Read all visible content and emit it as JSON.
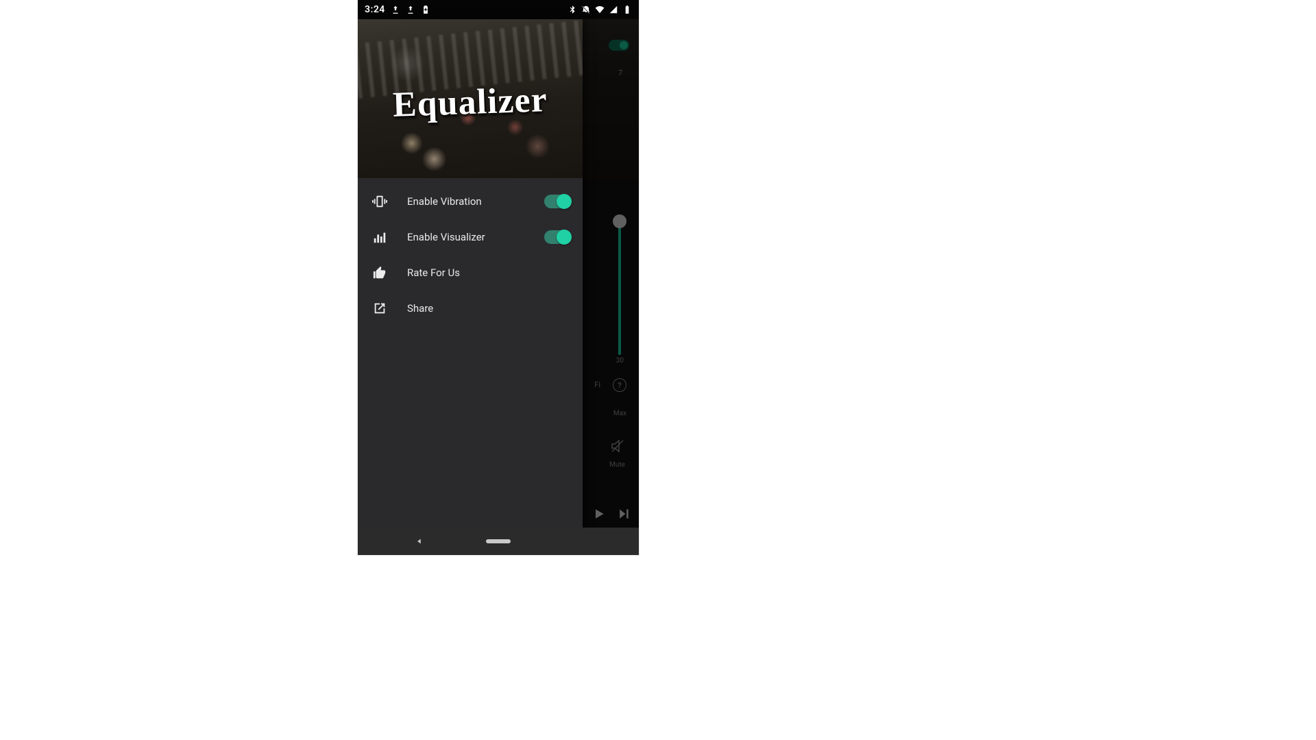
{
  "statusbar": {
    "time": "3:24"
  },
  "drawer": {
    "title": "Equalizer",
    "items": [
      {
        "label": "Enable Vibration",
        "has_switch": true,
        "switch_on": true
      },
      {
        "label": "Enable Visualizer",
        "has_switch": true,
        "switch_on": true
      },
      {
        "label": "Rate For Us",
        "has_switch": false
      },
      {
        "label": "Share",
        "has_switch": false
      }
    ]
  },
  "background_app": {
    "master_toggle_on": true,
    "small_label_top": "7",
    "slider_value_label": "30",
    "fi_label": "Fi",
    "help_label": "?",
    "max_label": "Max",
    "mute_label": "Mute"
  }
}
